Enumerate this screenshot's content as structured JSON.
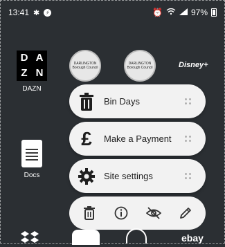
{
  "status": {
    "time": "13:41",
    "battery": "97%"
  },
  "apps": {
    "dazn": {
      "label": "DAZN",
      "tile_text": [
        "D",
        "A",
        "Z",
        "N"
      ]
    },
    "club1": {
      "tile_text": "DARLINGTON\nBorough Council"
    },
    "club2": {
      "tile_text": "DARLINGTON\nBorough Council"
    },
    "disney": {
      "tile_text": "Disney+"
    },
    "docs": {
      "label": "Docs"
    },
    "ebay": {
      "tile_text": "ebay"
    }
  },
  "shortcuts": [
    {
      "label": "Bin Days",
      "icon": "trash-icon"
    },
    {
      "label": "Make a Payment",
      "icon": "pound-sign-icon"
    },
    {
      "label": "Site settings",
      "icon": "gear-icon"
    }
  ],
  "actions": [
    {
      "icon": "trash-icon"
    },
    {
      "icon": "info-icon"
    },
    {
      "icon": "eye-off-icon"
    },
    {
      "icon": "pencil-icon"
    }
  ]
}
